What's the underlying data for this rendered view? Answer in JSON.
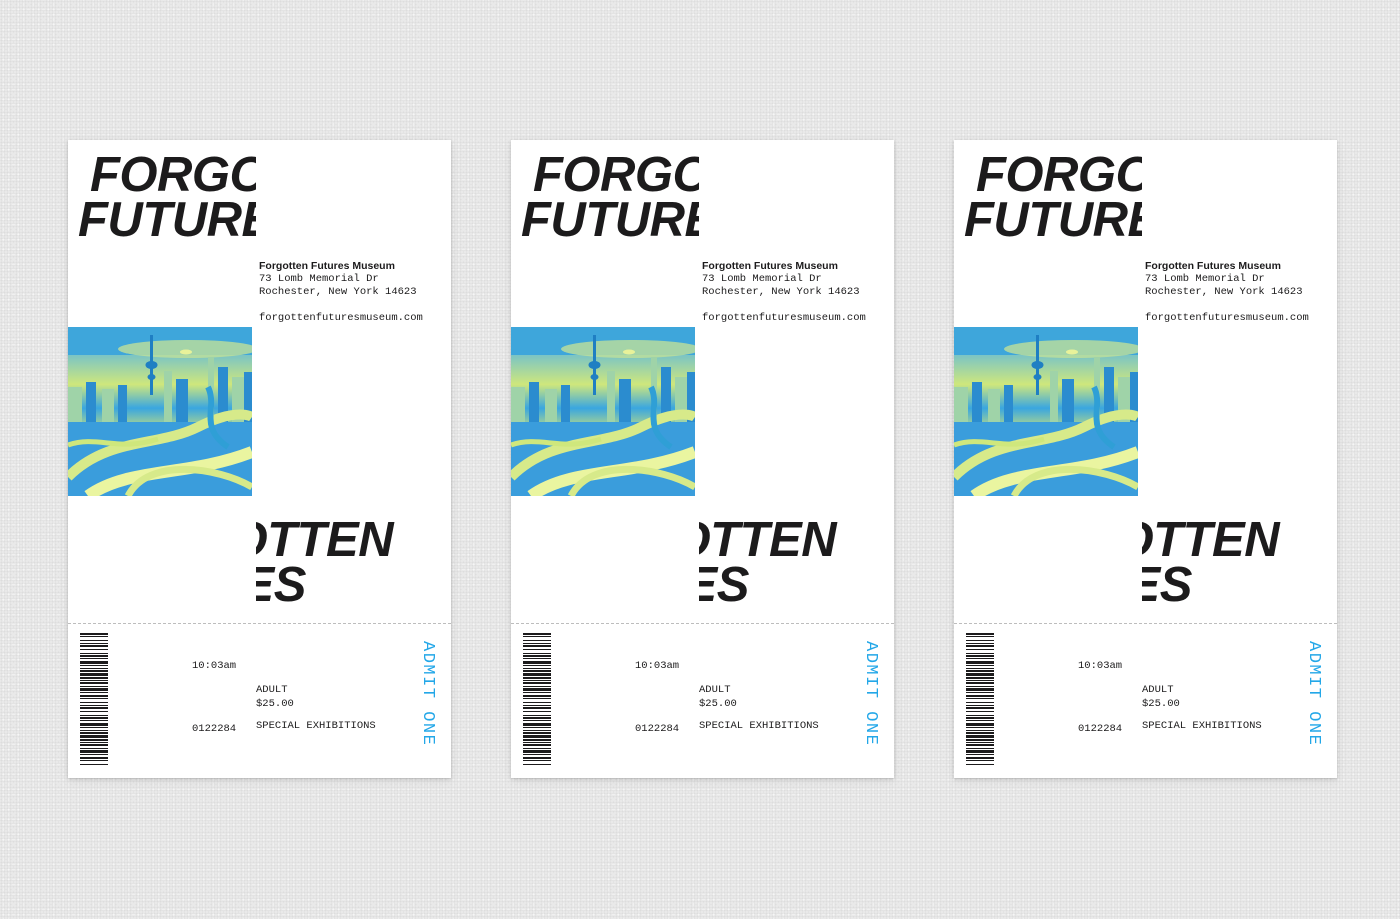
{
  "colors": {
    "background": "#e9e9e9",
    "ticket": "#ffffff",
    "ink": "#1c1b1c",
    "accent_blue": "#23a7e8",
    "photo_yellow": "#d7ea8a",
    "photo_blue": "#2f9fd6"
  },
  "tickets": [
    {
      "title": {
        "line1": "FORGOTTEN",
        "line2": "FUTURES"
      },
      "venue": {
        "name": "Forgotten Futures Museum",
        "address_line1": "73 Lomb Memorial Dr",
        "address_line2": "Rochester, New York 14623",
        "website": "forgottenfuturesmuseum.com"
      },
      "photo_icon": "futuristic-city-image",
      "stub": {
        "time": "10:03am",
        "ticket_type": "ADULT",
        "exhibition": "SPECIAL EXHIBITIONS",
        "price": "$25.00",
        "serial": "0122284",
        "admit": "ADMIT ONE",
        "barcode_icon": "barcode-icon"
      }
    },
    {
      "title": {
        "line1": "FORGOTTEN",
        "line2": "FUTURES"
      },
      "venue": {
        "name": "Forgotten Futures Museum",
        "address_line1": "73 Lomb Memorial Dr",
        "address_line2": "Rochester, New York 14623",
        "website": "forgottenfuturesmuseum.com"
      },
      "photo_icon": "futuristic-city-image",
      "stub": {
        "time": "10:03am",
        "ticket_type": "ADULT",
        "exhibition": "SPECIAL EXHIBITIONS",
        "price": "$25.00",
        "serial": "0122284",
        "admit": "ADMIT ONE",
        "barcode_icon": "barcode-icon"
      }
    },
    {
      "title": {
        "line1": "FORGOTTEN",
        "line2": "FUTURES"
      },
      "venue": {
        "name": "Forgotten Futures Museum",
        "address_line1": "73 Lomb Memorial Dr",
        "address_line2": "Rochester, New York 14623",
        "website": "forgottenfuturesmuseum.com"
      },
      "photo_icon": "futuristic-city-image",
      "stub": {
        "time": "10:03am",
        "ticket_type": "ADULT",
        "exhibition": "SPECIAL EXHIBITIONS",
        "price": "$25.00",
        "serial": "0122284",
        "admit": "ADMIT ONE",
        "barcode_icon": "barcode-icon"
      }
    }
  ]
}
